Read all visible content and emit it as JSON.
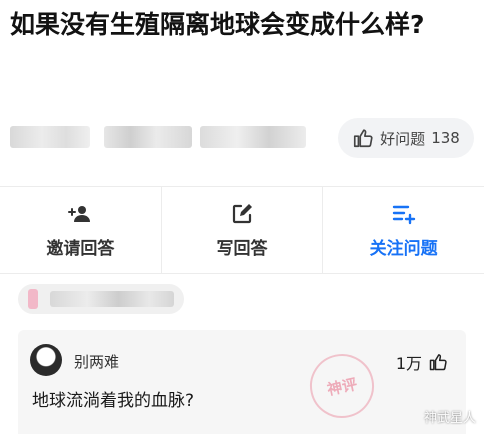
{
  "question": {
    "title": "如果没有生殖隔离地球会变成什么样?"
  },
  "good_question": {
    "label": "好问题",
    "count": "138"
  },
  "actions": [
    {
      "label": "邀请回答",
      "icon": "add-user-icon"
    },
    {
      "label": "写回答",
      "icon": "edit-icon"
    },
    {
      "label": "关注问题",
      "icon": "follow-list-icon"
    }
  ],
  "answer": {
    "author": "别两难",
    "likes": "1万",
    "content": "地球流淌着我的血脉?",
    "stamp": "神评"
  },
  "watermark": "神武星人",
  "colors": {
    "accent": "#1772f6",
    "card_bg": "#f6f6f6"
  }
}
